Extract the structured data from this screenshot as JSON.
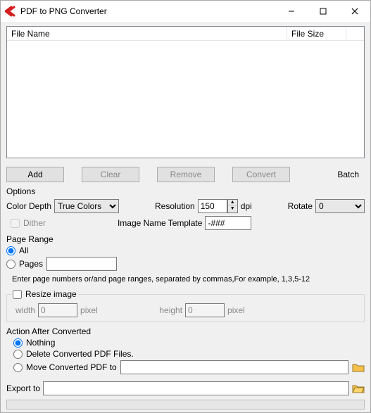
{
  "window": {
    "title": "PDF to PNG Converter"
  },
  "list": {
    "col_name": "File Name",
    "col_size": "File Size"
  },
  "buttons": {
    "add": "Add",
    "clear": "Clear",
    "remove": "Remove",
    "convert": "Convert",
    "batch": "Batch"
  },
  "options": {
    "legend": "Options",
    "color_depth_label": "Color Depth",
    "color_depth_value": "True Colors",
    "resolution_label": "Resolution",
    "resolution_value": "150",
    "resolution_unit": "dpi",
    "rotate_label": "Rotate",
    "rotate_value": "0",
    "dither_label": "Dither",
    "template_label": "Image Name Template",
    "template_value": "-###"
  },
  "pagerange": {
    "legend": "Page Range",
    "all": "All",
    "pages": "Pages",
    "pages_value": "",
    "hint": "Enter page numbers or/and page ranges, separated by commas,For example, 1,3,5-12"
  },
  "resize": {
    "label": "Resize image",
    "width_label": "width",
    "width_value": "0",
    "height_label": "height",
    "height_value": "0",
    "unit": "pixel"
  },
  "action": {
    "legend": "Action After Converted",
    "nothing": "Nothing",
    "delete": "Delete Converted PDF Files.",
    "move": "Move Converted PDF to",
    "move_path": ""
  },
  "export": {
    "label": "Export to",
    "value": ""
  }
}
